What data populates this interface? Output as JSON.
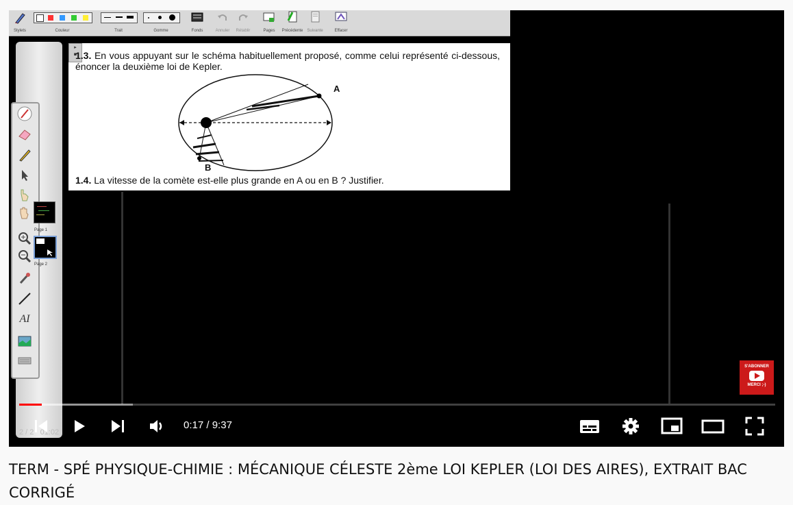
{
  "toolbar": {
    "groups": [
      {
        "label": "Stylets",
        "icon": "pen-icon"
      },
      {
        "label": "Couleur",
        "icon": "color-swatches"
      },
      {
        "label": "Trait",
        "icon": "line-width"
      },
      {
        "label": "Gomme",
        "icon": "eraser-size"
      },
      {
        "label": "Fonds",
        "icon": "background-icon"
      },
      {
        "label": "Annuler",
        "icon": "undo-icon"
      },
      {
        "label": "Rétablir",
        "icon": "redo-icon"
      },
      {
        "label": "Pages",
        "icon": "pages-icon"
      },
      {
        "label": "Précédente",
        "icon": "previous-page-icon"
      },
      {
        "label": "Suivante",
        "icon": "next-page-icon"
      },
      {
        "label": "Effacer",
        "icon": "clear-icon"
      }
    ],
    "swatch_colors": [
      "#ffffff",
      "#ff3333",
      "#3399ff",
      "#33cc33",
      "#ffee33"
    ]
  },
  "sidebar": {
    "tool_icons": [
      "pen-tool-icon",
      "eraser-tool-icon",
      "pencil-icon",
      "pointer-icon",
      "hand-icon",
      "hand-open-icon",
      "zoom-in-icon",
      "zoom-out-icon",
      "dropper-icon",
      "line-tool-icon",
      "text-tool-icon",
      "image-tool-icon",
      "keyboard-icon"
    ],
    "text_tool_glyph": "AI",
    "thumbnails": [
      {
        "label": "Page 1"
      },
      {
        "label": "Page 2"
      }
    ]
  },
  "document": {
    "q13_num": "1.3.",
    "q13_text": "En vous appuyant sur le schéma habituellement proposé, comme celui représenté ci-dessous, énoncer la deuxième loi de Kepler.",
    "label_a": "A",
    "label_b": "B",
    "q14_num": "1.4.",
    "q14_text": "La vitesse de la comète est-elle plus grande en A ou en B ? Justifier."
  },
  "subscribe": {
    "line1": "S'ABONNER",
    "line2": "MERCI ;-)",
    "color": "#cc1a1a"
  },
  "player": {
    "current_time": "0:17",
    "separator": " / ",
    "duration": "9:37",
    "played_fraction": 0.03,
    "buffered_fraction": 0.15,
    "corner_text": "2 / 2   01:02",
    "progress_color": "#ff0000"
  },
  "video_title": "TERM - SPÉ PHYSIQUE-CHIMIE : MÉCANIQUE CÉLESTE 2ème LOI KEPLER (LOI DES AIRES), EXTRAIT BAC CORRIGÉ"
}
